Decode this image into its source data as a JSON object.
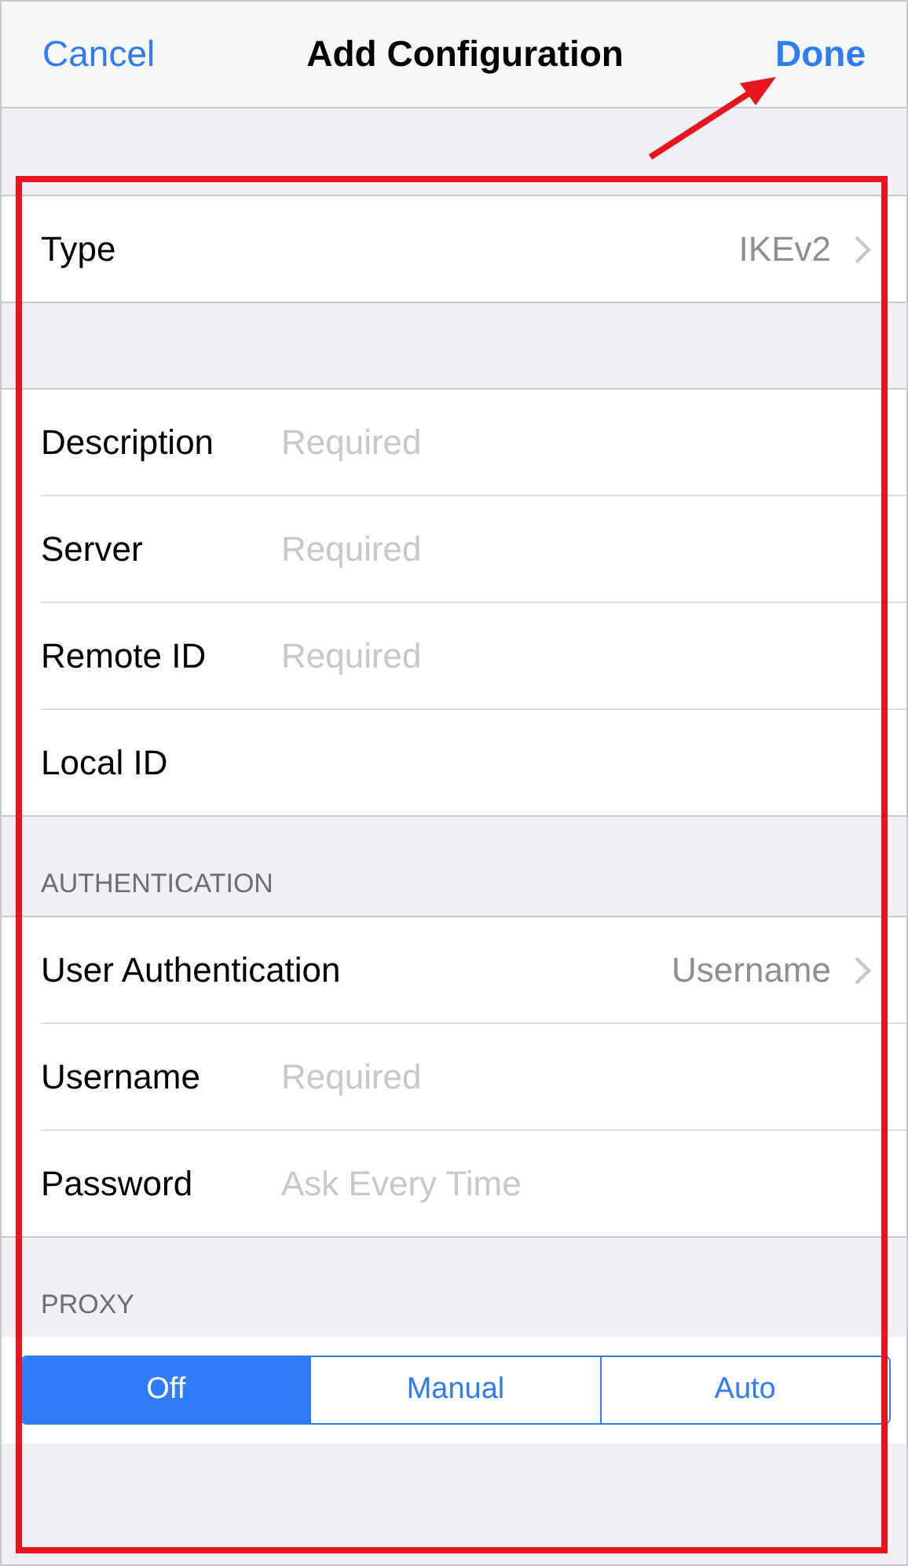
{
  "nav": {
    "cancel": "Cancel",
    "title": "Add Configuration",
    "done": "Done"
  },
  "sections": [
    {
      "rows": [
        {
          "kind": "detail",
          "label": "Type",
          "value": "IKEv2"
        }
      ]
    },
    {
      "rows": [
        {
          "kind": "field",
          "label": "Description",
          "placeholder": "Required"
        },
        {
          "kind": "field",
          "label": "Server",
          "placeholder": "Required"
        },
        {
          "kind": "field",
          "label": "Remote ID",
          "placeholder": "Required"
        },
        {
          "kind": "field",
          "label": "Local ID"
        }
      ]
    },
    {
      "header": "AUTHENTICATION",
      "rows": [
        {
          "kind": "detail",
          "label": "User Authentication",
          "value": "Username"
        },
        {
          "kind": "field",
          "label": "Username",
          "placeholder": "Required"
        },
        {
          "kind": "field",
          "label": "Password",
          "placeholder": "Ask Every Time"
        }
      ]
    },
    {
      "header": "PROXY",
      "segments": [
        {
          "label": "Off",
          "selected": true
        },
        {
          "label": "Manual",
          "selected": false
        },
        {
          "label": "Auto",
          "selected": false
        }
      ]
    }
  ]
}
